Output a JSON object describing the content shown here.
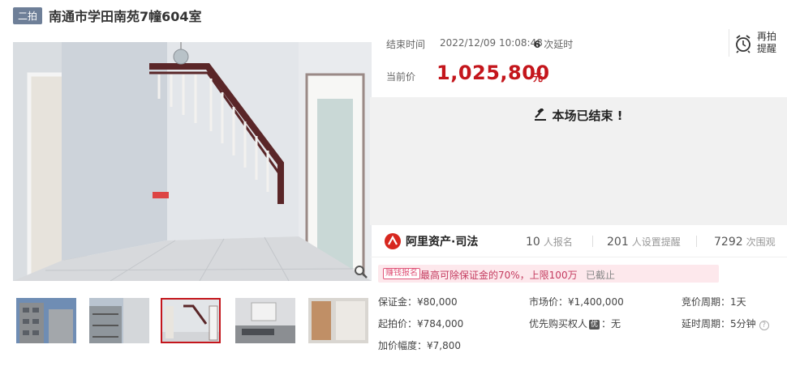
{
  "header": {
    "round_badge": "二拍",
    "title": "南通市学田南苑7幢604室"
  },
  "auction": {
    "end_label": "结束时间",
    "end_time": "2022/12/09 10:08:48",
    "extend_count": "6",
    "extend_suffix": "次延时",
    "price_label": "当前价",
    "price": "1,025,800",
    "price_unit": "元",
    "remind_label": "再拍提醒",
    "ended_text": "本场已结束 !"
  },
  "stats": {
    "brand": "阿里资产·司法",
    "signups": "10",
    "signups_label": "人报名",
    "reminders": "201",
    "reminders_label": "人设置提醒",
    "views": "7292",
    "views_label": "次围观"
  },
  "promo": {
    "tag": "赚钱报名",
    "text": "最高可除保证金的70%，上限100万",
    "status": "已截止"
  },
  "terms": {
    "deposit": "保证金：¥80,000",
    "start_price": "起拍价：¥784,000",
    "increment": "加价幅度：¥7,800",
    "market_price": "市场价：¥1,400,000",
    "priority_prefix": "优先购买权人",
    "priority_badge": "优",
    "priority_value": "：无",
    "bid_period": "竞价周期：1天",
    "extend_period": "延时周期：5分钟"
  },
  "icons": {
    "zoom": "magnifier-icon",
    "remind": "alarm-clock-icon",
    "ended": "gavel-icon",
    "brand": "ali-asset-logo-icon",
    "help": "question-icon"
  },
  "colors": {
    "accent_red": "#c4161c",
    "badge_gray": "#6e7f98",
    "promo_bg": "#fde8ec",
    "promo_text": "#c43b5f"
  }
}
